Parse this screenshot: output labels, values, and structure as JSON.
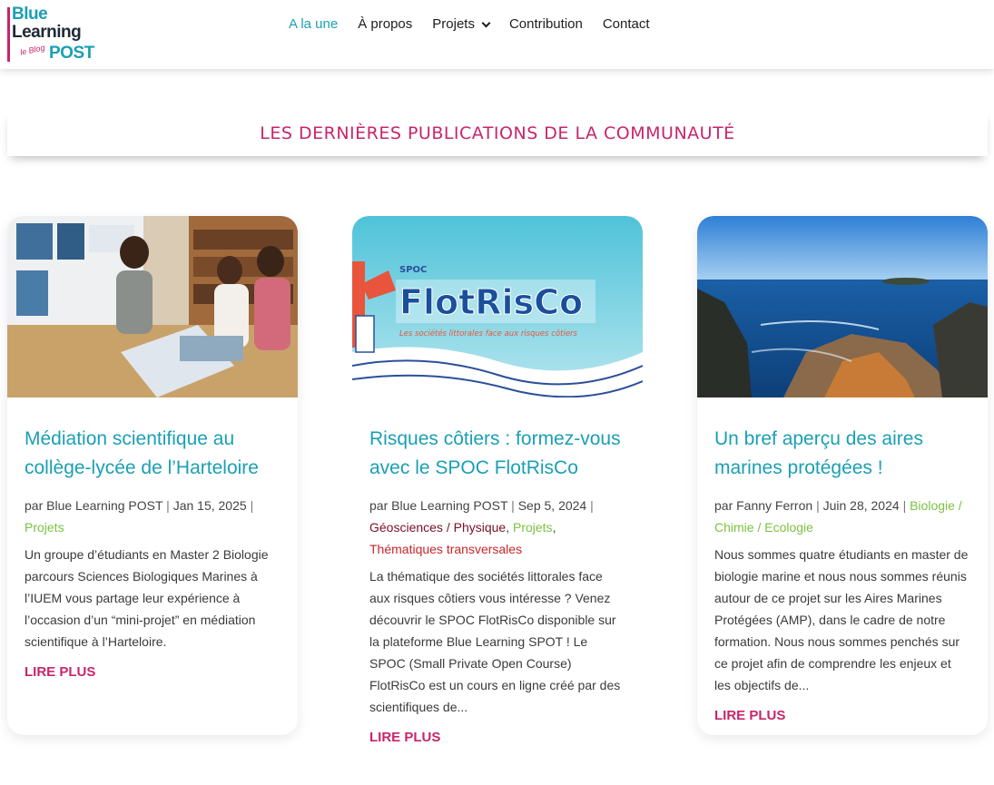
{
  "logo": {
    "line1": "Blue",
    "line2": "Learning",
    "line3": "POST",
    "tagline": "le Blog"
  },
  "nav": {
    "items": [
      {
        "label": "A la une",
        "active": true
      },
      {
        "label": "À propos"
      },
      {
        "label": "Projets",
        "dropdown": true
      },
      {
        "label": "Contribution"
      },
      {
        "label": "Contact"
      }
    ]
  },
  "section_title": "LES DERNIÈRES PUBLICATIONS DE LA COMMUNAUTÉ",
  "colors": {
    "accent": "#1a9fb5",
    "brand_pink": "#c8256b",
    "category_green": "#7cc142"
  },
  "posts": [
    {
      "title": "Médiation scientifique au collège-lycée de l’Harteloire",
      "author_prefix": "par",
      "author": "Blue Learning POST",
      "date": "Jan 15, 2025",
      "categories": [
        "Projets"
      ],
      "excerpt": "Un groupe d’étudiants en Master 2 Biologie parcours Sciences Biologiques Marines à l’IUEM vous partage leur expérience à l’occasion d’un “mini-projet” en médiation scientifique à l’Harteloire.",
      "read_more": "LIRE PLUS"
    },
    {
      "title": "Risques côtiers : formez-vous avec le SPOC FlotRisCo",
      "author_prefix": "par",
      "author": "Blue Learning POST",
      "date": "Sep 5, 2024",
      "categories": [
        "Géosciences / Physique",
        "Projets",
        "Thématiques transversales"
      ],
      "excerpt": "La thématique des sociétés littorales face aux risques côtiers vous intéresse ? Venez découvrir le SPOC FlotRisCo disponible sur la plateforme Blue Learning SPOT ! Le SPOC (Small Private Open Course) FlotRisCo est un cours en ligne créé par des scientifiques de...",
      "read_more": "LIRE PLUS",
      "image_text": {
        "small": "SPOC",
        "title": "FlotRisCo",
        "subtitle": "Les sociétés littorales face aux risques côtiers"
      }
    },
    {
      "title": "Un bref aperçu des aires marines protégées !",
      "author_prefix": "par",
      "author": "Fanny Ferron",
      "date": "Juin 28, 2024",
      "categories": [
        "Biologie / Chimie / Ecologie"
      ],
      "excerpt": "Nous sommes quatre étudiants en master de biologie marine et nous nous sommes réunis autour de ce projet sur les Aires Marines Protégées (AMP), dans le cadre de notre formation. Nous nous sommes penchés sur ce projet afin de comprendre les enjeux et les objectifs de...",
      "read_more": "LIRE PLUS"
    }
  ]
}
